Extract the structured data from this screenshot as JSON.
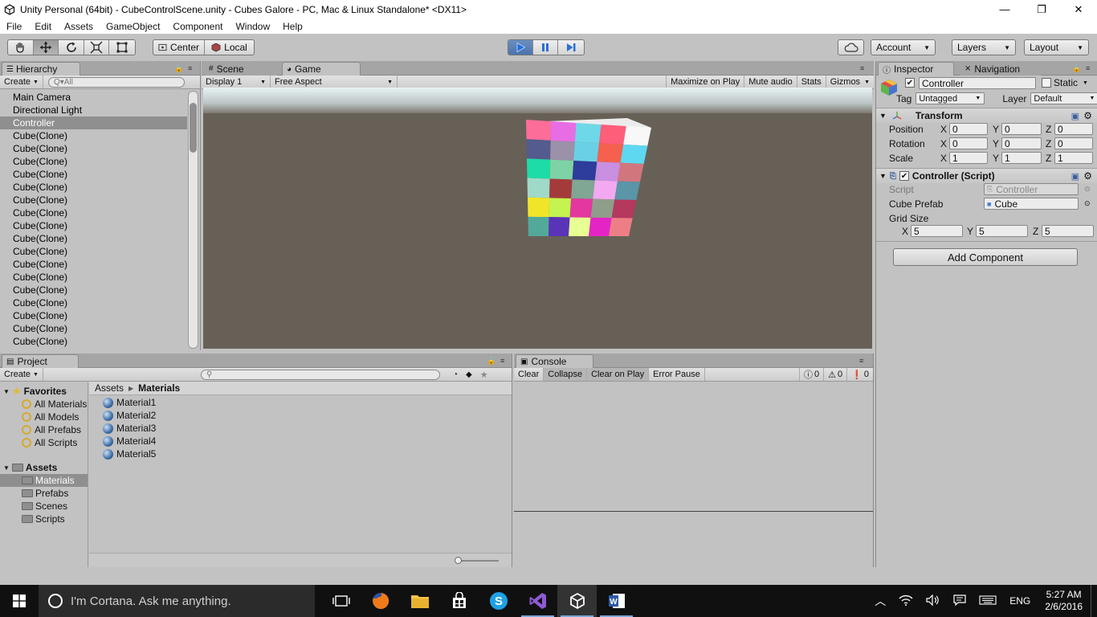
{
  "window": {
    "title": "Unity Personal (64bit) - CubeControlScene.unity - Cubes Galore - PC, Mac & Linux Standalone* <DX11>",
    "minimize": "—",
    "restore": "❐",
    "close": "✕"
  },
  "menu": [
    "File",
    "Edit",
    "Assets",
    "GameObject",
    "Component",
    "Window",
    "Help"
  ],
  "toolbar": {
    "pivot": "Center",
    "space": "Local",
    "account": "Account",
    "layers": "Layers",
    "layout": "Layout"
  },
  "hierarchy": {
    "tab": "Hierarchy",
    "create": "Create",
    "search_placeholder": "Q▾All",
    "items": [
      "Main Camera",
      "Directional Light",
      "Controller",
      "Cube(Clone)",
      "Cube(Clone)",
      "Cube(Clone)",
      "Cube(Clone)",
      "Cube(Clone)",
      "Cube(Clone)",
      "Cube(Clone)",
      "Cube(Clone)",
      "Cube(Clone)",
      "Cube(Clone)",
      "Cube(Clone)",
      "Cube(Clone)",
      "Cube(Clone)",
      "Cube(Clone)",
      "Cube(Clone)",
      "Cube(Clone)",
      "Cube(Clone)"
    ],
    "selected_index": 2
  },
  "scene_tabs": {
    "scene": "Scene",
    "game": "Game",
    "display": "Display 1",
    "aspect": "Free Aspect",
    "maximize": "Maximize on Play",
    "mute": "Mute audio",
    "stats": "Stats",
    "gizmos": "Gizmos"
  },
  "cube_colors": [
    [
      "#fd6d9a",
      "#e86de4",
      "#6ed8e8",
      "#ff5e7a",
      "#f8f8f8"
    ],
    [
      "#545b8f",
      "#9b91a8",
      "#6ad0e6",
      "#f5614e",
      "#5ed8f0"
    ],
    [
      "#1ddca7",
      "#7dd3a5",
      "#2e3c9a",
      "#c98fe0",
      "#d2767e"
    ],
    [
      "#9fd9c8",
      "#a43b3b",
      "#80a694",
      "#f3a9f2",
      "#5b95a8"
    ],
    [
      "#f1e52a",
      "#c4f44f",
      "#e5389f",
      "#8e9e8a",
      "#b5385e"
    ],
    [
      "#52a99a",
      "#5a34b8",
      "#e8ff93",
      "#e524c6",
      "#ee7e86"
    ]
  ],
  "inspector": {
    "tab": "Inspector",
    "nav_tab": "Navigation",
    "object_name": "Controller",
    "static": "Static",
    "tag_label": "Tag",
    "tag_value": "Untagged",
    "layer_label": "Layer",
    "layer_value": "Default",
    "transform": {
      "title": "Transform",
      "rows": [
        {
          "label": "Position",
          "x": "0",
          "y": "0",
          "z": "0"
        },
        {
          "label": "Rotation",
          "x": "0",
          "y": "0",
          "z": "0"
        },
        {
          "label": "Scale",
          "x": "1",
          "y": "1",
          "z": "1"
        }
      ]
    },
    "script": {
      "title": "Controller (Script)",
      "script_label": "Script",
      "script_value": "Controller",
      "prefab_label": "Cube Prefab",
      "prefab_value": "Cube",
      "grid_label": "Grid Size",
      "grid_x": "5",
      "grid_y": "5",
      "grid_z": "5"
    },
    "axis_x": "X",
    "axis_y": "Y",
    "axis_z": "Z",
    "add_component": "Add Component"
  },
  "project": {
    "tab": "Project",
    "create": "Create",
    "favorites": "Favorites",
    "fav_items": [
      "All Materials",
      "All Models",
      "All Prefabs",
      "All Scripts"
    ],
    "assets": "Assets",
    "asset_folders": [
      "Materials",
      "Prefabs",
      "Scenes",
      "Scripts"
    ],
    "breadcrumb_root": "Assets",
    "breadcrumb_current": "Materials",
    "materials": [
      "Material1",
      "Material2",
      "Material3",
      "Material4",
      "Material5"
    ]
  },
  "console": {
    "tab": "Console",
    "clear": "Clear",
    "collapse": "Collapse",
    "clear_on_play": "Clear on Play",
    "error_pause": "Error Pause",
    "info_count": "0",
    "warn_count": "0",
    "error_count": "0"
  },
  "taskbar": {
    "cortana": "I'm Cortana. Ask me anything.",
    "lang": "ENG",
    "time": "5:27 AM",
    "date": "2/6/2016"
  }
}
